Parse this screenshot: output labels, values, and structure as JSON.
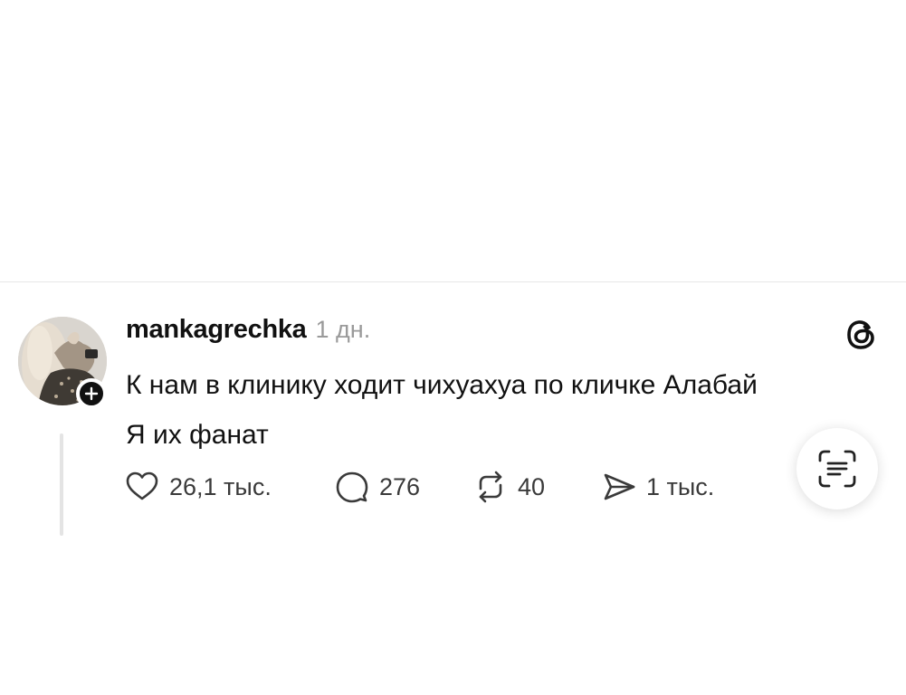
{
  "post": {
    "username": "mankagrechka",
    "time": "1 дн.",
    "lines": [
      "К нам в клинику ходит чихуахуа по кличке Алабай",
      "Я их фанат"
    ],
    "actions": {
      "likes": "26,1 тыс.",
      "comments": "276",
      "reposts": "40",
      "shares": "1 тыс."
    }
  },
  "icons": {
    "like": "heart-icon",
    "comment": "comment-bubble-icon",
    "repost": "repost-icon",
    "share": "send-icon",
    "brand": "threads-logo-icon",
    "follow": "plus-icon",
    "scan": "text-scan-icon"
  },
  "colors": {
    "text": "#111111",
    "muted": "#9a9a9a",
    "divider": "#e7e7e7"
  }
}
